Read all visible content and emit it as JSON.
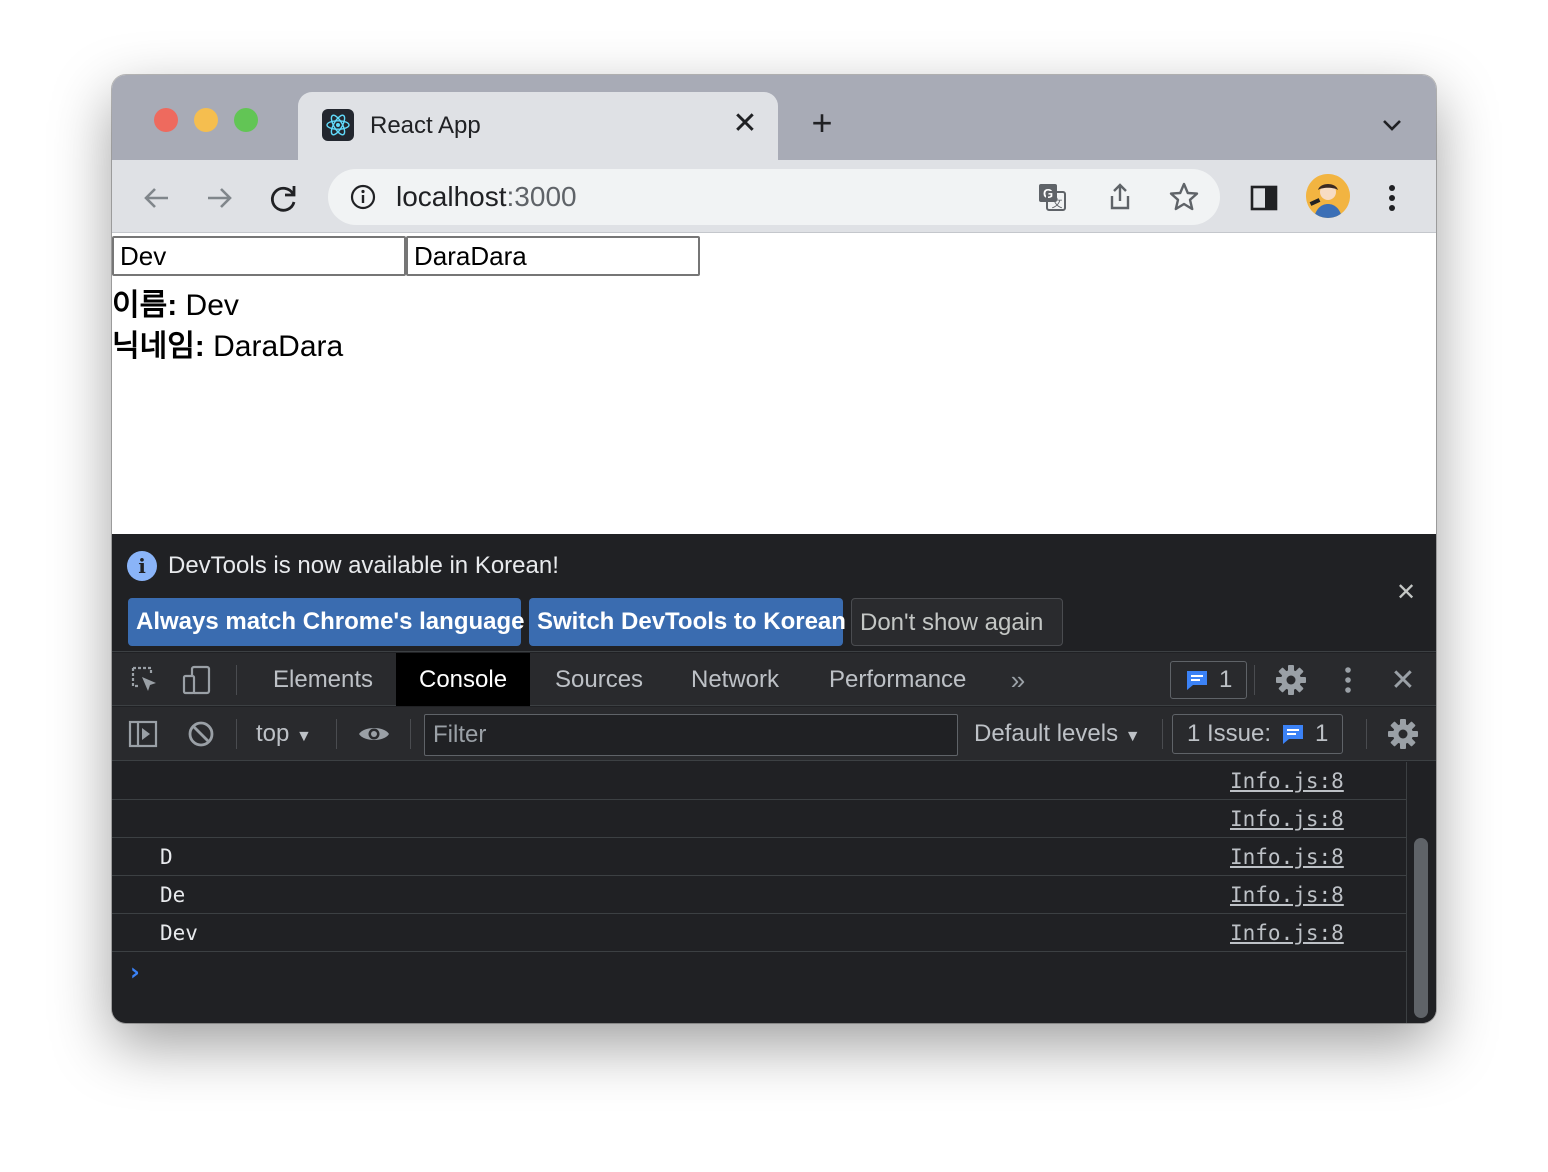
{
  "browser": {
    "tab": {
      "title": "React App",
      "favicon": "react-logo-icon"
    },
    "address": {
      "host": "localhost",
      "port": ":3000"
    }
  },
  "page": {
    "name_input": {
      "value": "Dev"
    },
    "nickname_input": {
      "value": "DaraDara"
    },
    "name_line": {
      "label": "이름:",
      "value": "Dev"
    },
    "nickname_line": {
      "label": "닉네임:",
      "value": "DaraDara"
    }
  },
  "devtools": {
    "infobar": {
      "message": "DevTools is now available in Korean!",
      "buttons": [
        "Always match Chrome's language",
        "Switch DevTools to Korean",
        "Don't show again"
      ]
    },
    "tabs": [
      "Elements",
      "Console",
      "Sources",
      "Network",
      "Performance"
    ],
    "active_tab": "Console",
    "issues_badge_count": "1",
    "console_toolbar": {
      "context": "top",
      "filter_placeholder": "Filter",
      "levels": "Default levels",
      "issues_label": "1 Issue:",
      "issues_count": "1"
    },
    "console_rows": [
      {
        "text": "",
        "source": "Info.js:8"
      },
      {
        "text": "",
        "source": "Info.js:8"
      },
      {
        "text": "D",
        "source": "Info.js:8"
      },
      {
        "text": "De",
        "source": "Info.js:8"
      },
      {
        "text": "Dev",
        "source": "Info.js:8"
      }
    ]
  },
  "colors": {
    "accent_button": "#3a6cb0",
    "console_prompt": "#3b82f6",
    "issue_icon": "#3b82f6"
  }
}
